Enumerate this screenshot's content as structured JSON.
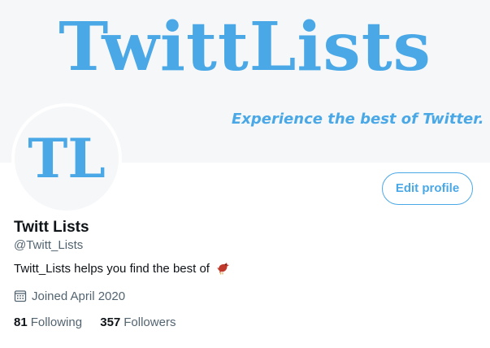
{
  "banner": {
    "title": "TwittLists",
    "tagline": "Experience the best of Twitter."
  },
  "avatar": {
    "text": "TL"
  },
  "actions": {
    "edit_profile_label": "Edit profile"
  },
  "profile": {
    "name": "Twitt Lists",
    "handle": "@Twitt_Lists",
    "bio": "Twitt_Lists helps you find the best of",
    "bio_emoji": "bird-icon",
    "joined": "Joined April 2020",
    "joined_icon": "calendar-icon"
  },
  "stats": {
    "following_count": "81",
    "following_label": "Following",
    "followers_count": "357",
    "followers_label": "Followers"
  },
  "colors": {
    "brand_blue": "#4aa8e6",
    "text_primary": "#0f1419",
    "text_secondary": "#536471",
    "banner_bg": "#f5f7f9"
  }
}
